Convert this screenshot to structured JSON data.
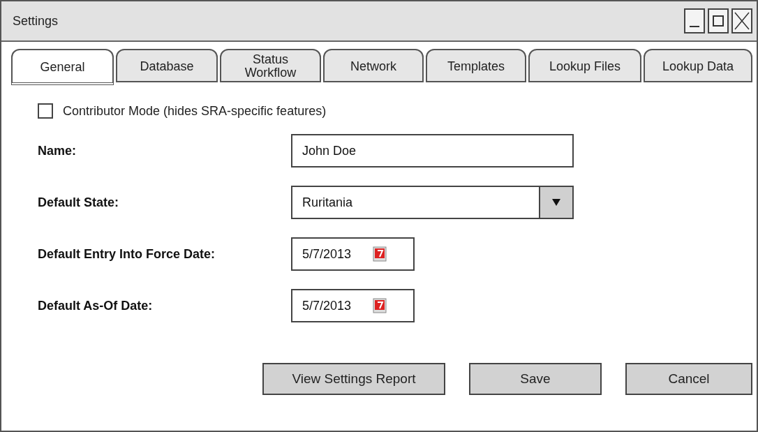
{
  "window": {
    "title": "Settings"
  },
  "tabs": [
    {
      "label": "General",
      "selected": true
    },
    {
      "label": "Database",
      "selected": false
    },
    {
      "label": "Status Workflow",
      "selected": false
    },
    {
      "label": "Network",
      "selected": false
    },
    {
      "label": "Templates",
      "selected": false
    },
    {
      "label": "Lookup Files",
      "selected": false
    },
    {
      "label": "Lookup Data",
      "selected": false
    }
  ],
  "contributor_mode": {
    "label": "Contributor Mode (hides SRA-specific features)",
    "checked": false
  },
  "fields": [
    {
      "kind": "text",
      "label": "Name:",
      "value": "John Doe"
    },
    {
      "kind": "select",
      "label": "Default State:",
      "value": "Ruritania"
    },
    {
      "kind": "date",
      "label": "Default Entry Into Force Date:",
      "value": "5/7/2013"
    },
    {
      "kind": "date",
      "label": "Default As-Of Date:",
      "value": "5/7/2013"
    }
  ],
  "buttons": [
    "View Settings Report",
    "Save",
    "Cancel"
  ]
}
